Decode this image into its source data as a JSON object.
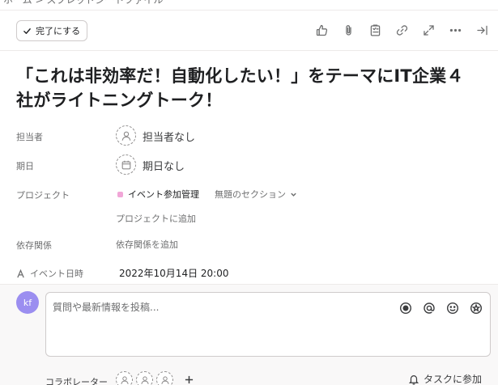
{
  "breadcrumb": {
    "text": "ホーム > スプレッドシートファイル"
  },
  "toolbar": {
    "complete_label": "完了にする",
    "icons": [
      "like-icon",
      "attachment-icon",
      "subtask-icon",
      "link-icon",
      "expand-icon",
      "more-icon",
      "close-pane-icon"
    ]
  },
  "task": {
    "title": "「これは非効率だ！自動化したい！」をテーマにIT企業４社がライトニングトーク！"
  },
  "fields": {
    "assignee_label": "担当者",
    "assignee_value": "担当者なし",
    "due_label": "期日",
    "due_value": "期日なし",
    "project_label": "プロジェクト",
    "project_name": "イベント参加管理",
    "project_color": "#f1a6d7",
    "section_name": "無題のセクション",
    "add_project": "プロジェクトに追加",
    "dependency_label": "依存関係",
    "add_dependency": "依存関係を追加",
    "event_label": "イベント日時",
    "event_value": "2022年10月14日 20:00"
  },
  "comment": {
    "avatar_initials": "kf",
    "avatar_color": "#9b8ef0",
    "placeholder": "質問や最新情報を投稿...",
    "collaborators_label": "コラボレーター",
    "join_task": "タスクに参加"
  }
}
